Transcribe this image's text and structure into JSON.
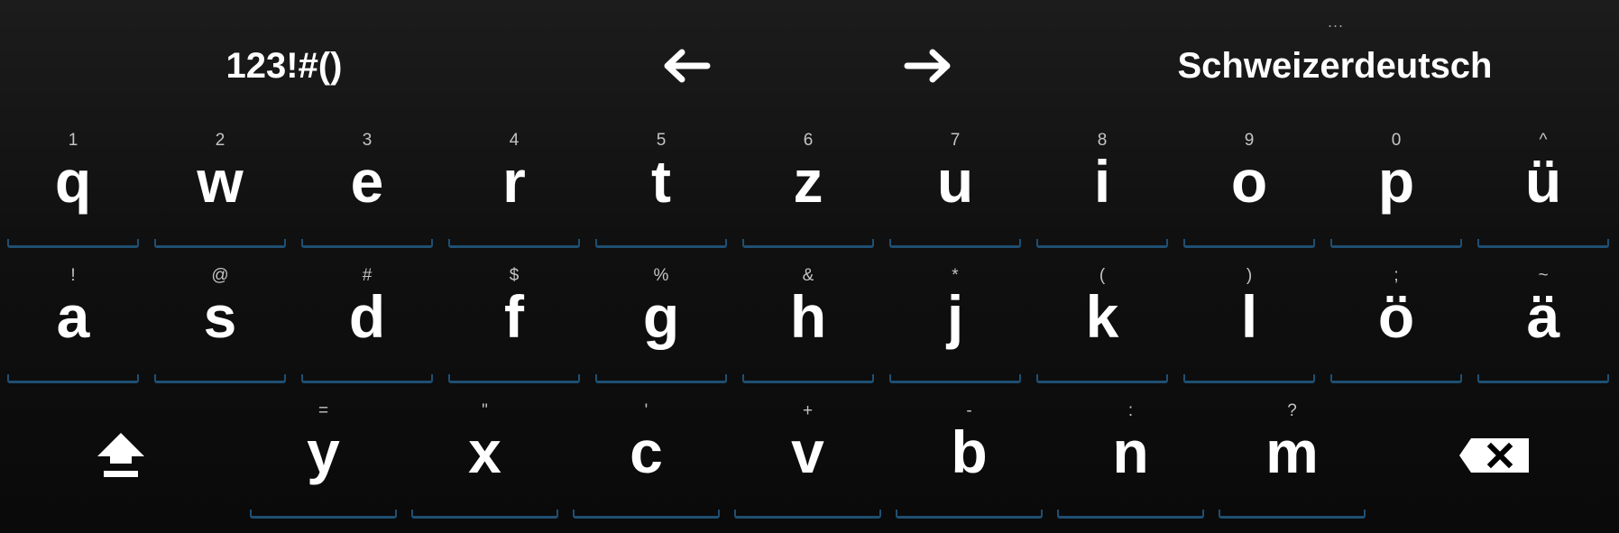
{
  "top_bar": {
    "symbols_label": "123!#()",
    "left_arrow": "←",
    "right_arrow": "→",
    "language_label": "Schweizerdeutsch",
    "more_indicator": "..."
  },
  "keyboard": {
    "row1": [
      {
        "letter": "q",
        "hint": "1"
      },
      {
        "letter": "w",
        "hint": "2"
      },
      {
        "letter": "e",
        "hint": "3"
      },
      {
        "letter": "r",
        "hint": "4"
      },
      {
        "letter": "t",
        "hint": "5"
      },
      {
        "letter": "z",
        "hint": "6"
      },
      {
        "letter": "u",
        "hint": "7"
      },
      {
        "letter": "i",
        "hint": "8"
      },
      {
        "letter": "o",
        "hint": "9"
      },
      {
        "letter": "p",
        "hint": "0"
      },
      {
        "letter": "ü",
        "hint": "^"
      }
    ],
    "row2": [
      {
        "letter": "a",
        "hint": "!"
      },
      {
        "letter": "s",
        "hint": "@"
      },
      {
        "letter": "d",
        "hint": "#"
      },
      {
        "letter": "f",
        "hint": "$"
      },
      {
        "letter": "g",
        "hint": "%"
      },
      {
        "letter": "h",
        "hint": "&"
      },
      {
        "letter": "j",
        "hint": "*"
      },
      {
        "letter": "k",
        "hint": "("
      },
      {
        "letter": "l",
        "hint": ")"
      },
      {
        "letter": "ö",
        "hint": ";"
      },
      {
        "letter": "ä",
        "hint": "~"
      }
    ],
    "row3": [
      {
        "letter": "y",
        "hint": "="
      },
      {
        "letter": "x",
        "hint": "\""
      },
      {
        "letter": "c",
        "hint": "'"
      },
      {
        "letter": "v",
        "hint": "+"
      },
      {
        "letter": "b",
        "hint": "-"
      },
      {
        "letter": "n",
        "hint": ":"
      },
      {
        "letter": "m",
        "hint": "?"
      }
    ],
    "shift_icon": "shift-icon",
    "backspace_icon": "backspace-icon"
  },
  "colors": {
    "background": "#111111",
    "key_underline": "#1f4f72",
    "hint_text": "#c4c4c4",
    "key_text": "#ffffff"
  }
}
